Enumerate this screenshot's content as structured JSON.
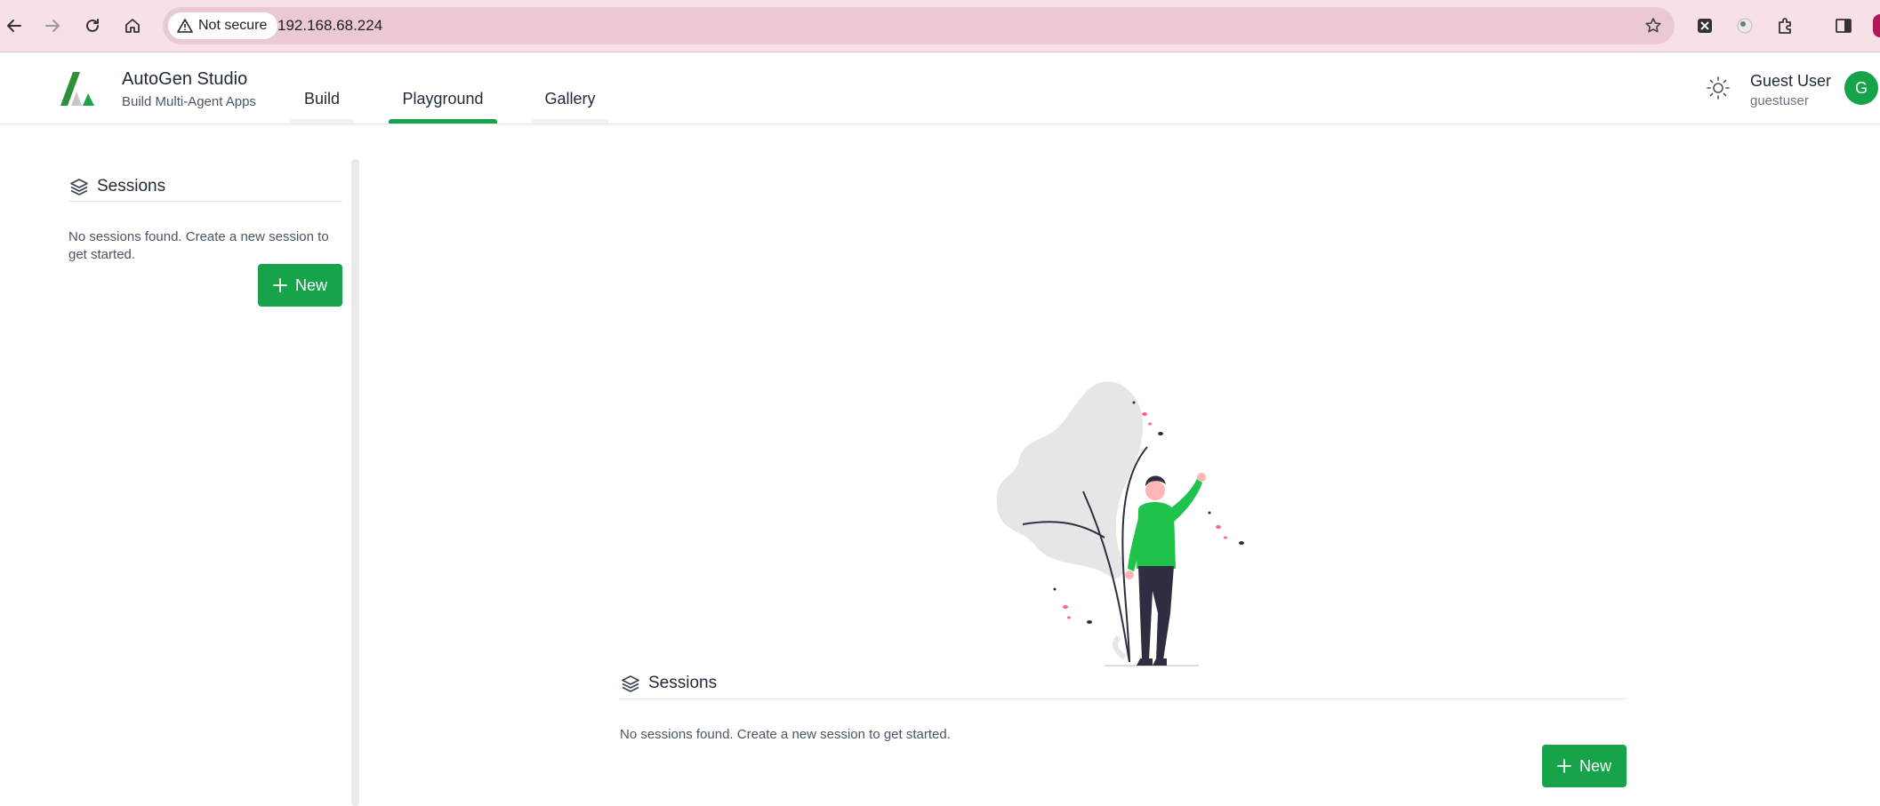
{
  "browser": {
    "security_label": "Not secure",
    "url": "192.168.68.224"
  },
  "app": {
    "title": "AutoGen Studio",
    "subtitle": "Build Multi-Agent Apps",
    "tabs": [
      {
        "label": "Build",
        "active": false
      },
      {
        "label": "Playground",
        "active": true
      },
      {
        "label": "Gallery",
        "active": false
      }
    ],
    "user": {
      "name": "Guest User",
      "handle": "guestuser",
      "initial": "G"
    }
  },
  "sidebar": {
    "title": "Sessions",
    "empty_message": "No sessions found. Create a new session to get started.",
    "new_button": "New"
  },
  "main": {
    "title": "Sessions",
    "empty_message": "No sessions found. Create a new session to get started.",
    "new_button": "New"
  },
  "colors": {
    "accent": "#16a34a",
    "browser_bar": "#f7e1e7"
  }
}
